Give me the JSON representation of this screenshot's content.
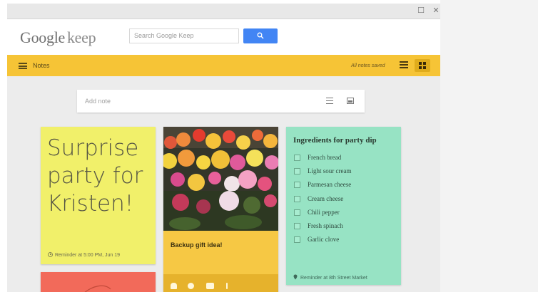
{
  "window": {
    "maximize_glyph": "☐",
    "close_glyph": "✕"
  },
  "header": {
    "logo_google": "Google",
    "logo_keep": "keep",
    "search_placeholder": "Search Google Keep",
    "search_button_icon": "search-icon"
  },
  "toolbar": {
    "menu_icon": "hamburger-icon",
    "notes_label": "Notes",
    "status": "All notes saved",
    "list_view_icon": "list-view-icon",
    "grid_view_icon": "grid-view-icon"
  },
  "add_note": {
    "placeholder": "Add note",
    "list_icon": "list-icon",
    "image_icon": "image-icon"
  },
  "notes": [
    {
      "color": "#f1f06a",
      "text_lines": [
        "Surprise",
        "party for",
        "Kristen!"
      ],
      "reminder": "Reminder at 5:00 PM, Jun 19",
      "reminder_icon": "clock-icon"
    },
    {
      "color": "#f6c844",
      "title": "Backup gift idea!",
      "image": "photo-of-flowers",
      "actions": [
        "bell-icon",
        "palette-icon",
        "image-icon",
        "more-icon"
      ]
    },
    {
      "color": "#97e3c4",
      "title": "Ingredients for party dip",
      "items": [
        "French bread",
        "Light sour cream",
        "Parmesan cheese",
        "Cream cheese",
        "Chili pepper",
        "Fresh spinach",
        "Garlic clove"
      ],
      "reminder": "Reminder at 8th Street Market",
      "reminder_icon": "location-pin-icon"
    },
    {
      "color": "#f26a5a"
    }
  ]
}
